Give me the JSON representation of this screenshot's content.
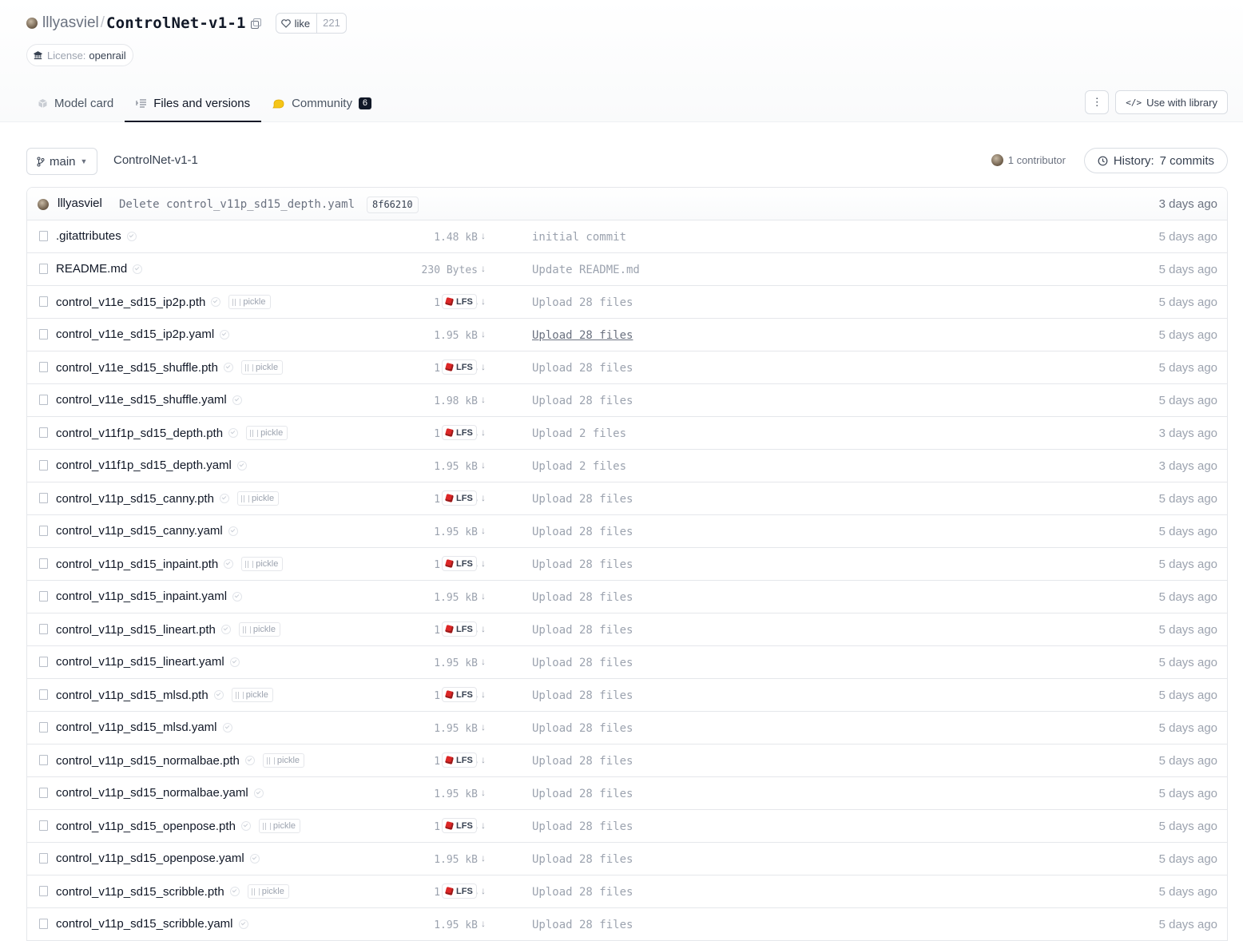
{
  "repo": {
    "owner": "lllyasviel",
    "separator": "/",
    "name": "ControlNet-v1-1",
    "like_label": "like",
    "like_count": "221",
    "license_key": "License:",
    "license_value": "openrail"
  },
  "tabs": [
    {
      "label": "Model card",
      "icon": "cube-icon"
    },
    {
      "label": "Files and versions",
      "icon": "files-icon",
      "active": true
    },
    {
      "label": "Community",
      "icon": "community-icon",
      "badge": "6"
    }
  ],
  "actions": {
    "more_label": "⋮",
    "use_with_library_label": "Use with library"
  },
  "branch": {
    "name": "main",
    "breadcrumb": "ControlNet-v1-1",
    "contributors": "1 contributor",
    "history_label": "History:",
    "history_count": "7 commits"
  },
  "last_commit": {
    "author": "lllyasviel",
    "message": "Delete control_v11p_sd15_depth.yaml",
    "hash": "8f66210",
    "date": "3 days ago"
  },
  "files": [
    {
      "name": ".gitattributes",
      "size": "1.48 kB",
      "pickle": false,
      "lfs": false,
      "commit": "initial commit",
      "date": "5 days ago"
    },
    {
      "name": "README.md",
      "size": "230 Bytes",
      "pickle": false,
      "lfs": false,
      "commit": "Update README.md",
      "date": "5 days ago"
    },
    {
      "name": "control_v11e_sd15_ip2p.pth",
      "size": "1.45 GB",
      "pickle": true,
      "lfs": true,
      "commit": "Upload 28 files",
      "date": "5 days ago"
    },
    {
      "name": "control_v11e_sd15_ip2p.yaml",
      "size": "1.95 kB",
      "pickle": false,
      "lfs": false,
      "commit": "Upload 28 files",
      "date": "5 days ago",
      "hover": true
    },
    {
      "name": "control_v11e_sd15_shuffle.pth",
      "size": "1.45 GB",
      "pickle": true,
      "lfs": true,
      "commit": "Upload 28 files",
      "date": "5 days ago"
    },
    {
      "name": "control_v11e_sd15_shuffle.yaml",
      "size": "1.98 kB",
      "pickle": false,
      "lfs": false,
      "commit": "Upload 28 files",
      "date": "5 days ago"
    },
    {
      "name": "control_v11f1p_sd15_depth.pth",
      "size": "1.45 GB",
      "pickle": true,
      "lfs": true,
      "commit": "Upload 2 files",
      "date": "3 days ago"
    },
    {
      "name": "control_v11f1p_sd15_depth.yaml",
      "size": "1.95 kB",
      "pickle": false,
      "lfs": false,
      "commit": "Upload 2 files",
      "date": "3 days ago"
    },
    {
      "name": "control_v11p_sd15_canny.pth",
      "size": "1.45 GB",
      "pickle": true,
      "lfs": true,
      "commit": "Upload 28 files",
      "date": "5 days ago"
    },
    {
      "name": "control_v11p_sd15_canny.yaml",
      "size": "1.95 kB",
      "pickle": false,
      "lfs": false,
      "commit": "Upload 28 files",
      "date": "5 days ago"
    },
    {
      "name": "control_v11p_sd15_inpaint.pth",
      "size": "1.45 GB",
      "pickle": true,
      "lfs": true,
      "commit": "Upload 28 files",
      "date": "5 days ago"
    },
    {
      "name": "control_v11p_sd15_inpaint.yaml",
      "size": "1.95 kB",
      "pickle": false,
      "lfs": false,
      "commit": "Upload 28 files",
      "date": "5 days ago"
    },
    {
      "name": "control_v11p_sd15_lineart.pth",
      "size": "1.45 GB",
      "pickle": true,
      "lfs": true,
      "commit": "Upload 28 files",
      "date": "5 days ago"
    },
    {
      "name": "control_v11p_sd15_lineart.yaml",
      "size": "1.95 kB",
      "pickle": false,
      "lfs": false,
      "commit": "Upload 28 files",
      "date": "5 days ago"
    },
    {
      "name": "control_v11p_sd15_mlsd.pth",
      "size": "1.45 GB",
      "pickle": true,
      "lfs": true,
      "commit": "Upload 28 files",
      "date": "5 days ago"
    },
    {
      "name": "control_v11p_sd15_mlsd.yaml",
      "size": "1.95 kB",
      "pickle": false,
      "lfs": false,
      "commit": "Upload 28 files",
      "date": "5 days ago"
    },
    {
      "name": "control_v11p_sd15_normalbae.pth",
      "size": "1.45 GB",
      "pickle": true,
      "lfs": true,
      "commit": "Upload 28 files",
      "date": "5 days ago"
    },
    {
      "name": "control_v11p_sd15_normalbae.yaml",
      "size": "1.95 kB",
      "pickle": false,
      "lfs": false,
      "commit": "Upload 28 files",
      "date": "5 days ago"
    },
    {
      "name": "control_v11p_sd15_openpose.pth",
      "size": "1.45 GB",
      "pickle": true,
      "lfs": true,
      "commit": "Upload 28 files",
      "date": "5 days ago"
    },
    {
      "name": "control_v11p_sd15_openpose.yaml",
      "size": "1.95 kB",
      "pickle": false,
      "lfs": false,
      "commit": "Upload 28 files",
      "date": "5 days ago"
    },
    {
      "name": "control_v11p_sd15_scribble.pth",
      "size": "1.45 GB",
      "pickle": true,
      "lfs": true,
      "commit": "Upload 28 files",
      "date": "5 days ago"
    },
    {
      "name": "control_v11p_sd15_scribble.yaml",
      "size": "1.95 kB",
      "pickle": false,
      "lfs": false,
      "commit": "Upload 28 files",
      "date": "5 days ago"
    }
  ],
  "labels": {
    "pickle": "pickle",
    "lfs": "LFS",
    "download_glyph": "↓"
  },
  "colors": {
    "lfs_red": "#dc2626",
    "community_yellow": "#f5c518"
  }
}
